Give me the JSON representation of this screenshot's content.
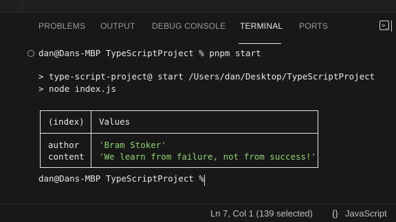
{
  "panel": {
    "tabs": [
      {
        "label": "PROBLEMS"
      },
      {
        "label": "OUTPUT"
      },
      {
        "label": "DEBUG CONSOLE"
      },
      {
        "label": "TERMINAL"
      },
      {
        "label": "PORTS"
      }
    ],
    "active_tab": "TERMINAL"
  },
  "terminal": {
    "command_line": "dan@Dans-MBP TypeScriptProject % pnpm start",
    "script_line": "> type-script-project@ start /Users/dan/Desktop/TypeScriptProject",
    "node_line": "> node index.js",
    "table": {
      "headers": [
        "(index)",
        "Values"
      ],
      "rows": [
        {
          "index": "author",
          "value": "'Bram Stoker'"
        },
        {
          "index": "content",
          "value": "'We learn from failure, not from success!'"
        }
      ]
    },
    "prompt_line": "dan@Dans-MBP TypeScriptProject % "
  },
  "statusbar": {
    "cursor_position": "Ln 7, Col 1 (139 selected)",
    "language_icon": "{}",
    "language": "JavaScript"
  },
  "colors": {
    "string": "#8fd16f",
    "background": "#181818",
    "text": "#e6e6e6"
  }
}
